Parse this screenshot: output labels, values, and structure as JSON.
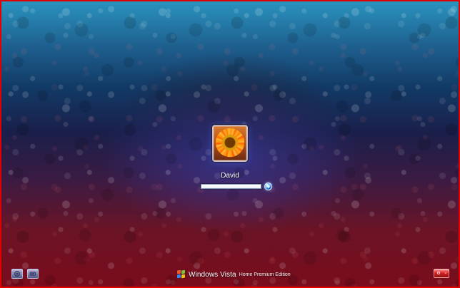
{
  "user": {
    "name": "David",
    "avatar_icon": "flower-avatar"
  },
  "login": {
    "password_value": "",
    "password_placeholder": ""
  },
  "branding": {
    "main": "Windows Vista",
    "edition": "Home Premium Edition"
  },
  "controls": {
    "ease_of_access_icon": "ease-of-access-icon",
    "language_icon": "keyboard-language-icon",
    "submit_icon": "arrow-right-icon",
    "power_icon": "power-icon",
    "power_menu_icon": "chevron-down-icon"
  },
  "colors": {
    "border": "#e00000",
    "submit_blue": "#1f63c7",
    "power_red": "#d72222"
  }
}
